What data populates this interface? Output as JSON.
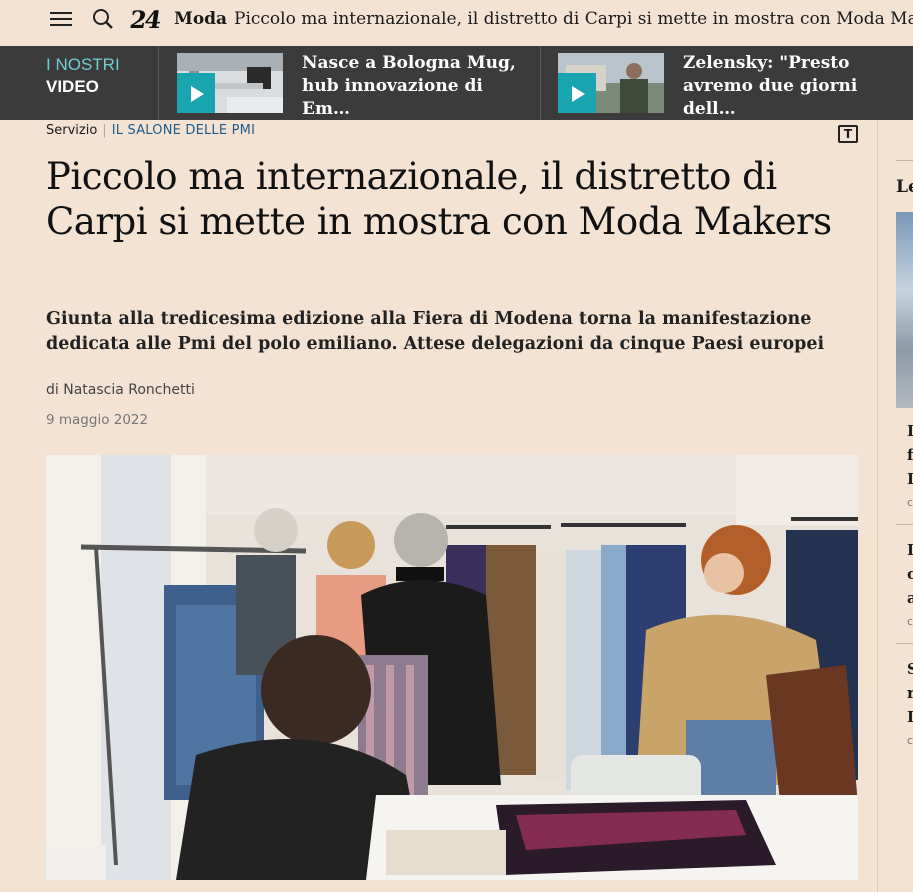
{
  "topbar": {
    "logo": "24",
    "section": "Moda",
    "headline": "Piccolo ma internazionale, il distretto di Carpi si mette in mostra con Moda Makers"
  },
  "videos": {
    "label_line1": "I NOSTRI",
    "label_line2": "VIDEO",
    "items": [
      {
        "title": "Nasce a Bologna Mug, hub innovazione di Em…"
      },
      {
        "title": "Zelensky: \"Presto avremo due giorni dell…"
      }
    ]
  },
  "article": {
    "kicker_type": "Servizio",
    "kicker_tag": "IL SALONE DELLE PMI",
    "text_size_icon": "T",
    "title": "Piccolo ma internazionale, il distretto di Carpi si mette in mostra con Moda Makers",
    "subtitle": "Giunta alla tredicesima edizione alla Fiera di Modena torna la manifestazione dedicata alle Pmi del polo emiliano. Attese delegazioni da cinque Paesi europei",
    "author": "di Natascia Ronchetti",
    "date": "9 maggio 2022"
  },
  "sidebar": {
    "heading": "Le",
    "items": [
      {
        "line1": "I",
        "line2": "f",
        "line3": "I",
        "meta": "c"
      },
      {
        "line1": "I",
        "line2": "c",
        "line3": "a",
        "meta": "c"
      },
      {
        "line1": "S",
        "line2": "r",
        "line3": "I",
        "meta": "c"
      }
    ]
  }
}
